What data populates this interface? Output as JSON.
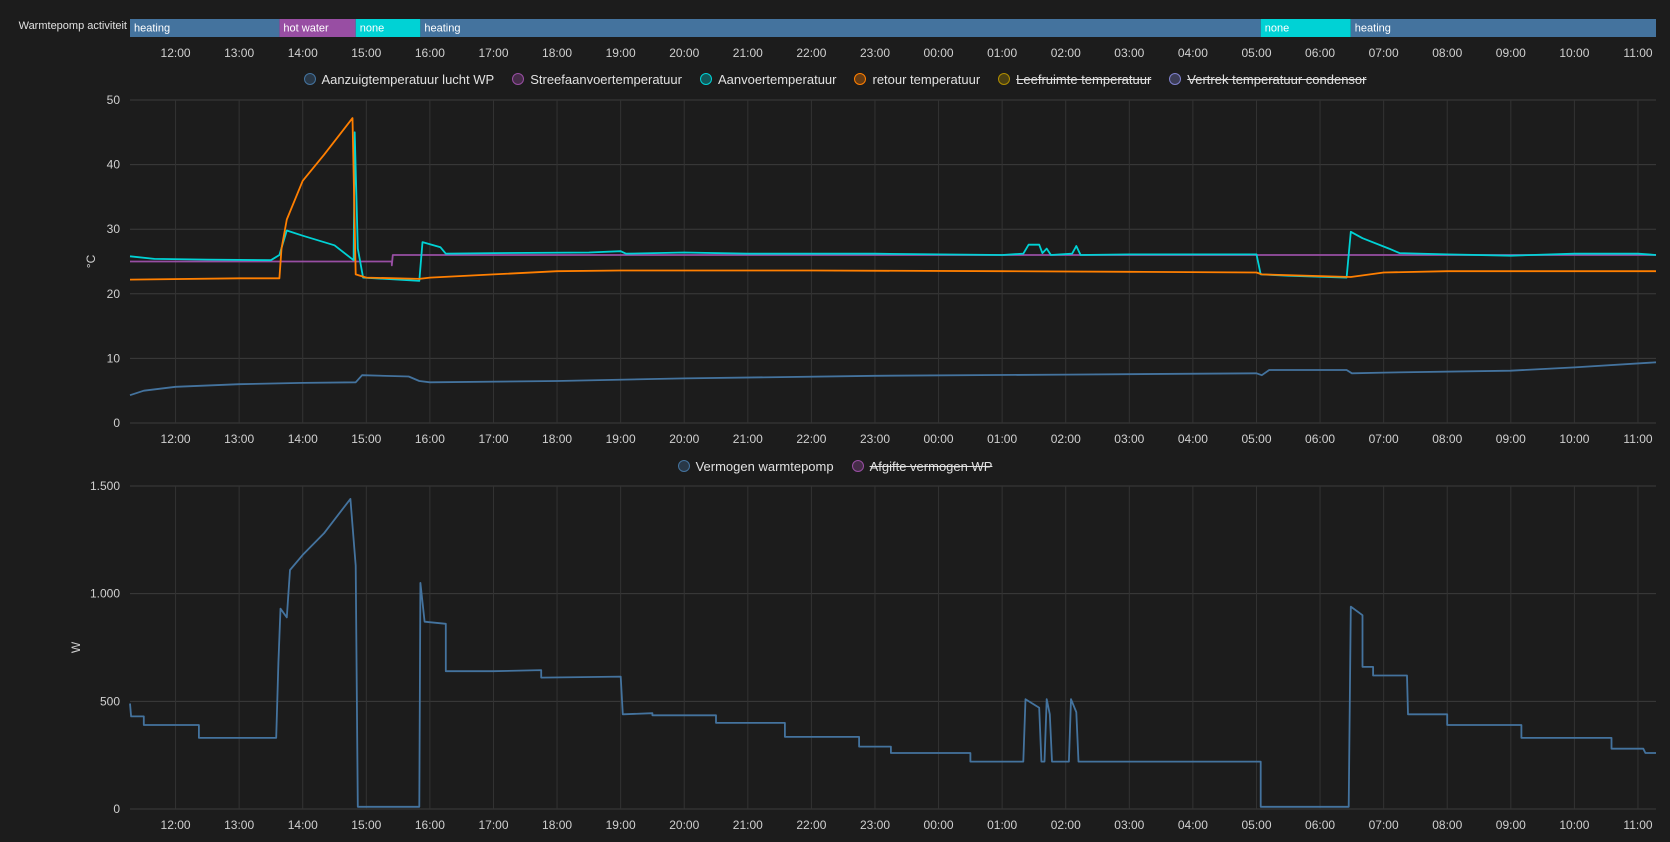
{
  "timeline": {
    "label": "Warmtepomp activiteit",
    "segments": [
      {
        "label": "heating",
        "start": "11:17",
        "end": "13:38",
        "color": "#44739e"
      },
      {
        "label": "hot water",
        "start": "13:38",
        "end": "14:50",
        "color": "#984ea3"
      },
      {
        "label": "none",
        "start": "14:50",
        "end": "15:51",
        "color": "#00d2d5"
      },
      {
        "label": "heating",
        "start": "15:51",
        "end": "05:04",
        "color": "#44739e"
      },
      {
        "label": "none",
        "start": "05:04",
        "end": "06:29",
        "color": "#00d2d5"
      },
      {
        "label": "heating",
        "start": "06:29",
        "end": "11:17",
        "color": "#44739e"
      }
    ]
  },
  "time_axis": {
    "start": "11:17",
    "end": "11:17",
    "ticks": [
      "12:00",
      "13:00",
      "14:00",
      "15:00",
      "16:00",
      "17:00",
      "18:00",
      "19:00",
      "20:00",
      "21:00",
      "22:00",
      "23:00",
      "00:00",
      "01:00",
      "02:00",
      "03:00",
      "04:00",
      "05:00",
      "06:00",
      "07:00",
      "08:00",
      "09:00",
      "10:00",
      "11:00"
    ]
  },
  "chart_data": [
    {
      "type": "line",
      "ylabel": "°C",
      "ylim": [
        0,
        50
      ],
      "yticks": [
        "0",
        "10",
        "20",
        "30",
        "40",
        "50"
      ],
      "legend": [
        {
          "name": "Aanzuigtemperatuur lucht WP",
          "color": "#44739e",
          "hidden": false
        },
        {
          "name": "Streefaanvoertemperatuur",
          "color": "#984ea3",
          "hidden": false
        },
        {
          "name": "Aanvoertemperatuur",
          "color": "#00d2d5",
          "hidden": false
        },
        {
          "name": "retour temperatuur",
          "color": "#ff7f00",
          "hidden": false
        },
        {
          "name": "Leefruimte temperatuur",
          "color": "#af8d00",
          "hidden": true
        },
        {
          "name": "Vertrek temperatuur condensor",
          "color": "#7f80cd",
          "hidden": true
        }
      ],
      "series": [
        {
          "name": "Aanzuigtemperatuur lucht WP",
          "color": "#44739e",
          "points": [
            [
              "11:17",
              4.3
            ],
            [
              "11:30",
              5.0
            ],
            [
              "12:00",
              5.6
            ],
            [
              "13:00",
              6.0
            ],
            [
              "14:00",
              6.2
            ],
            [
              "14:50",
              6.3
            ],
            [
              "14:56",
              7.4
            ],
            [
              "15:40",
              7.2
            ],
            [
              "15:50",
              6.5
            ],
            [
              "16:00",
              6.3
            ],
            [
              "18:00",
              6.5
            ],
            [
              "20:00",
              6.9
            ],
            [
              "23:00",
              7.3
            ],
            [
              "02:00",
              7.5
            ],
            [
              "05:00",
              7.7
            ],
            [
              "05:05",
              7.4
            ],
            [
              "05:12",
              8.2
            ],
            [
              "06:25",
              8.2
            ],
            [
              "06:30",
              7.7
            ],
            [
              "07:00",
              7.8
            ],
            [
              "09:00",
              8.1
            ],
            [
              "10:00",
              8.6
            ],
            [
              "11:17",
              9.4
            ]
          ]
        },
        {
          "name": "Streefaanvoertemperatuur",
          "color": "#984ea3",
          "points": [
            [
              "11:17",
              25.0
            ],
            [
              "15:24",
              25.0
            ],
            [
              "15:24",
              24.4
            ],
            [
              "15:25",
              26.0
            ],
            [
              "11:17",
              26.0
            ]
          ]
        },
        {
          "name": "Aanvoertemperatuur",
          "color": "#00d2d5",
          "points": [
            [
              "11:17",
              25.8
            ],
            [
              "11:40",
              25.4
            ],
            [
              "12:30",
              25.3
            ],
            [
              "13:30",
              25.2
            ],
            [
              "13:38",
              26.0
            ],
            [
              "13:45",
              29.8
            ],
            [
              "14:00",
              29.0
            ],
            [
              "14:30",
              27.5
            ],
            [
              "14:48",
              25.2
            ],
            [
              "14:49",
              45.0
            ],
            [
              "14:52",
              27.0
            ],
            [
              "14:57",
              22.5
            ],
            [
              "15:30",
              22.2
            ],
            [
              "15:50",
              22.0
            ],
            [
              "15:53",
              28.0
            ],
            [
              "16:10",
              27.2
            ],
            [
              "16:15",
              26.2
            ],
            [
              "17:00",
              26.3
            ],
            [
              "18:30",
              26.4
            ],
            [
              "19:00",
              26.6
            ],
            [
              "19:05",
              26.2
            ],
            [
              "20:00",
              26.4
            ],
            [
              "21:00",
              26.2
            ],
            [
              "23:00",
              26.2
            ],
            [
              "01:00",
              26.0
            ],
            [
              "01:20",
              26.2
            ],
            [
              "01:25",
              27.6
            ],
            [
              "01:35",
              27.6
            ],
            [
              "01:38",
              26.3
            ],
            [
              "01:42",
              27.0
            ],
            [
              "01:46",
              26.0
            ],
            [
              "02:06",
              26.2
            ],
            [
              "02:10",
              27.4
            ],
            [
              "02:14",
              26.0
            ],
            [
              "03:00",
              26.1
            ],
            [
              "05:00",
              26.1
            ],
            [
              "05:04",
              23.0
            ],
            [
              "05:30",
              22.8
            ],
            [
              "06:25",
              22.5
            ],
            [
              "06:29",
              29.6
            ],
            [
              "06:40",
              28.6
            ],
            [
              "07:05",
              27.0
            ],
            [
              "07:15",
              26.3
            ],
            [
              "08:00",
              26.1
            ],
            [
              "09:00",
              25.9
            ],
            [
              "10:00",
              26.2
            ],
            [
              "11:00",
              26.2
            ],
            [
              "11:17",
              26.0
            ]
          ]
        },
        {
          "name": "retour temperatuur",
          "color": "#ff7f00",
          "points": [
            [
              "11:17",
              22.2
            ],
            [
              "13:00",
              22.4
            ],
            [
              "13:38",
              22.4
            ],
            [
              "13:40",
              27.0
            ],
            [
              "13:45",
              31.5
            ],
            [
              "14:00",
              37.5
            ],
            [
              "14:20",
              41.5
            ],
            [
              "14:47",
              47.2
            ],
            [
              "14:50",
              23.0
            ],
            [
              "15:00",
              22.5
            ],
            [
              "15:50",
              22.3
            ],
            [
              "16:00",
              22.5
            ],
            [
              "17:00",
              23.0
            ],
            [
              "18:00",
              23.5
            ],
            [
              "19:00",
              23.6
            ],
            [
              "22:00",
              23.6
            ],
            [
              "01:00",
              23.5
            ],
            [
              "03:00",
              23.4
            ],
            [
              "05:00",
              23.3
            ],
            [
              "05:05",
              23.0
            ],
            [
              "06:29",
              22.6
            ],
            [
              "07:00",
              23.3
            ],
            [
              "08:00",
              23.5
            ],
            [
              "11:17",
              23.5
            ]
          ]
        }
      ]
    },
    {
      "type": "line",
      "ylabel": "W",
      "ylim": [
        0,
        1500
      ],
      "yticks": [
        "0",
        "500",
        "1.000",
        "1.500"
      ],
      "legend": [
        {
          "name": "Vermogen warmtepomp",
          "color": "#44739e",
          "hidden": false
        },
        {
          "name": "Afgifte vermogen WP",
          "color": "#984ea3",
          "hidden": true
        }
      ],
      "series": [
        {
          "name": "Vermogen warmtepomp",
          "color": "#44739e",
          "points": [
            [
              "11:17",
              490
            ],
            [
              "11:18",
              430
            ],
            [
              "11:30",
              430
            ],
            [
              "11:30",
              390
            ],
            [
              "12:22",
              390
            ],
            [
              "12:22",
              330
            ],
            [
              "13:35",
              330
            ],
            [
              "13:37",
              680
            ],
            [
              "13:39",
              930
            ],
            [
              "13:45",
              890
            ],
            [
              "13:48",
              1110
            ],
            [
              "14:00",
              1180
            ],
            [
              "14:20",
              1280
            ],
            [
              "14:45",
              1440
            ],
            [
              "14:50",
              1130
            ],
            [
              "14:52",
              10
            ],
            [
              "15:50",
              10
            ],
            [
              "15:51",
              1050
            ],
            [
              "15:55",
              870
            ],
            [
              "16:15",
              860
            ],
            [
              "16:15",
              640
            ],
            [
              "17:00",
              640
            ],
            [
              "17:45",
              645
            ],
            [
              "17:45",
              610
            ],
            [
              "19:00",
              615
            ],
            [
              "19:02",
              440
            ],
            [
              "19:30",
              445
            ],
            [
              "19:30",
              435
            ],
            [
              "20:30",
              435
            ],
            [
              "20:30",
              400
            ],
            [
              "21:35",
              400
            ],
            [
              "21:35",
              335
            ],
            [
              "22:45",
              335
            ],
            [
              "22:45",
              290
            ],
            [
              "23:15",
              290
            ],
            [
              "23:15",
              260
            ],
            [
              "00:30",
              260
            ],
            [
              "00:30",
              220
            ],
            [
              "01:20",
              220
            ],
            [
              "01:22",
              510
            ],
            [
              "01:35",
              470
            ],
            [
              "01:37",
              220
            ],
            [
              "01:40",
              220
            ],
            [
              "01:42",
              510
            ],
            [
              "01:45",
              440
            ],
            [
              "01:47",
              220
            ],
            [
              "02:03",
              220
            ],
            [
              "02:05",
              510
            ],
            [
              "02:10",
              450
            ],
            [
              "02:12",
              220
            ],
            [
              "03:00",
              220
            ],
            [
              "05:04",
              220
            ],
            [
              "05:04",
              10
            ],
            [
              "06:27",
              10
            ],
            [
              "06:29",
              940
            ],
            [
              "06:40",
              900
            ],
            [
              "06:40",
              660
            ],
            [
              "06:50",
              660
            ],
            [
              "06:50",
              620
            ],
            [
              "07:22",
              620
            ],
            [
              "07:23",
              440
            ],
            [
              "08:00",
              440
            ],
            [
              "08:00",
              390
            ],
            [
              "09:10",
              390
            ],
            [
              "09:10",
              330
            ],
            [
              "10:35",
              330
            ],
            [
              "10:35",
              280
            ],
            [
              "11:05",
              280
            ],
            [
              "11:07",
              260
            ],
            [
              "11:17",
              260
            ]
          ]
        }
      ]
    }
  ]
}
